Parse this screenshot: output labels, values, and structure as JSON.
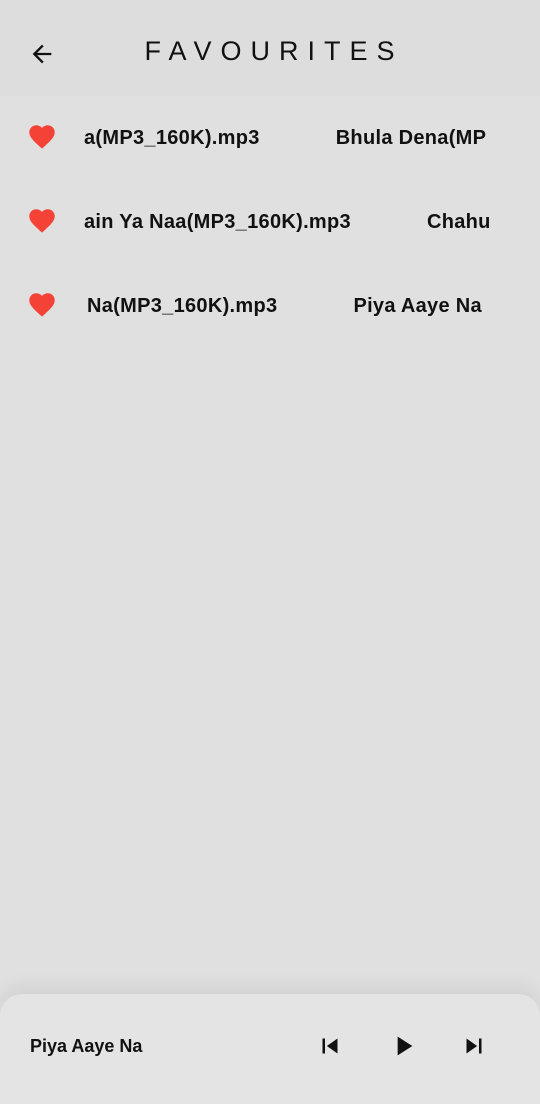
{
  "header": {
    "title": "FAVOURITES",
    "back_icon": "arrow-left-icon"
  },
  "favourites": [
    {
      "text_visible": "a(MP3_160K).mp3",
      "next_text_visible": "Bhula Dena(MP",
      "icon": "heart-icon"
    },
    {
      "text_visible": "ain Ya Naa(MP3_160K).mp3",
      "next_text_visible": "Chahu",
      "icon": "heart-icon"
    },
    {
      "text_visible": "Na(MP3_160K).mp3",
      "next_text_visible": "Piya Aaye Na",
      "icon": "heart-icon"
    }
  ],
  "player": {
    "now_playing": "Piya Aaye Na",
    "controls": [
      "skip-previous-icon",
      "play-icon",
      "skip-next-icon"
    ]
  },
  "colors": {
    "background": "#e0e0e0",
    "heart": "#f44336",
    "text": "#111111"
  }
}
